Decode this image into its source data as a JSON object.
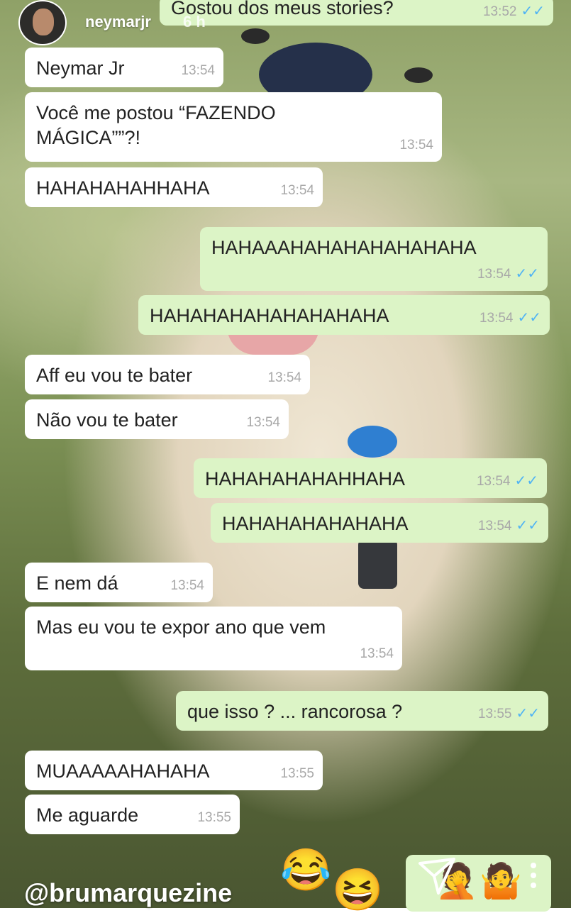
{
  "story": {
    "username": "neymarjr",
    "age": "6 h",
    "mention": "@brumarquezine"
  },
  "messages": [
    {
      "text": "Gostou dos meus stories?",
      "time": "13:52",
      "side": "out"
    },
    {
      "text": "Neymar Jr",
      "time": "13:54",
      "side": "in"
    },
    {
      "text": "Você me postou “FAZENDO MÁGICA””?!",
      "time": "13:54",
      "side": "in"
    },
    {
      "text": "HAHAHAHAHHAHA",
      "time": "13:54",
      "side": "in"
    },
    {
      "text": "HAHAAAHAHAHAHAHAHAHA",
      "time": "13:54",
      "side": "out"
    },
    {
      "text": "HAHAHAHAHAHAHAHAHA",
      "time": "13:54",
      "side": "out"
    },
    {
      "text": "Aff eu vou te bater",
      "time": "13:54",
      "side": "in"
    },
    {
      "text": "Não vou te bater",
      "time": "13:54",
      "side": "in"
    },
    {
      "text": "HAHAHAHAHAHHAHA",
      "time": "13:54",
      "side": "out"
    },
    {
      "text": "HAHAHAHAHAHAHA",
      "time": "13:54",
      "side": "out"
    },
    {
      "text": "E nem dá",
      "time": "13:54",
      "side": "in"
    },
    {
      "text": "Mas eu vou te expor ano que vem",
      "time": "13:54",
      "side": "in"
    },
    {
      "text": "que isso ? ... rancorosa ?",
      "time": "13:55",
      "side": "out"
    },
    {
      "text": "MUAAAAAHAHAHA",
      "time": "13:55",
      "side": "in"
    },
    {
      "text": "Me aguarde",
      "time": "13:55",
      "side": "in"
    }
  ],
  "icons": {
    "read_receipt": "double-check-icon",
    "emoji_1": "😂",
    "emoji_2": "😆",
    "emoji_3": "🤦",
    "emoji_4": "🤷"
  },
  "colors": {
    "incoming": "#ffffff",
    "outgoing": "#dcf4c6",
    "read_receipt": "#4fb3f4"
  }
}
